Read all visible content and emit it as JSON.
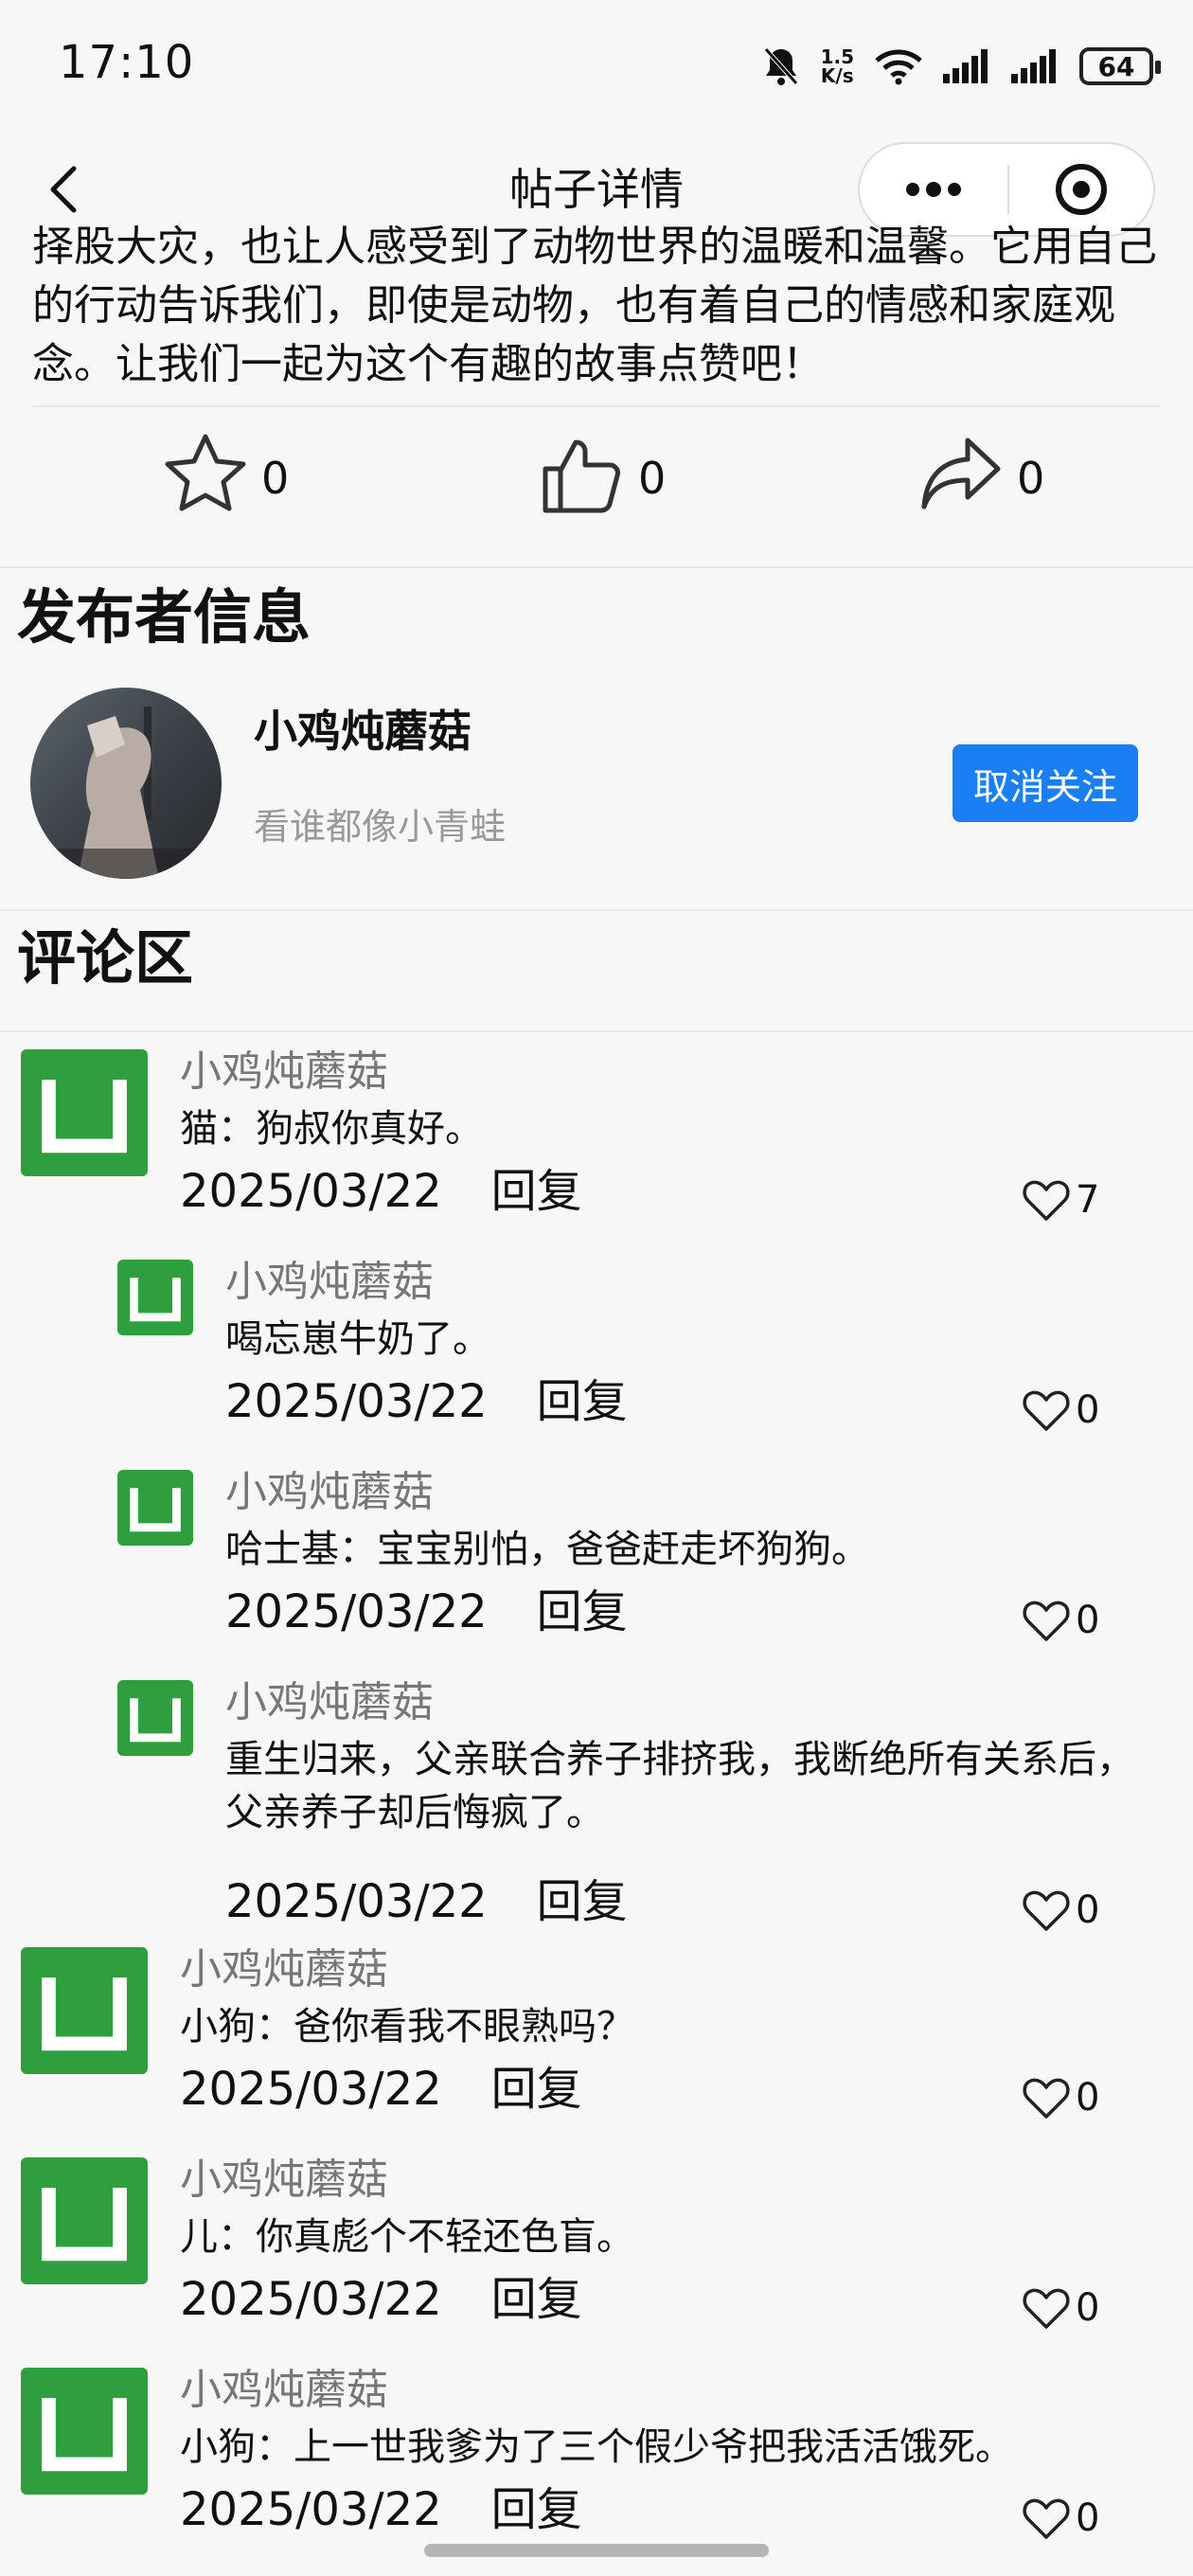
{
  "status_bar": {
    "time": "17:10",
    "speed_value": "1.5",
    "speed_unit": "K/s",
    "battery": "64",
    "icons": [
      "bell-muted-icon",
      "network-speed",
      "wifi-icon",
      "signal-icon",
      "signal-icon",
      "battery-icon"
    ]
  },
  "nav": {
    "title": "帖子详情",
    "back_icon": "chevron-left-icon",
    "more_icon": "more-dots-icon",
    "close_icon": "target-close-icon"
  },
  "post": {
    "text": "择股大灾，也让人感受到了动物世界的温暖和温馨。它用自己的行动告诉我们，即使是动物，也有着自己的情感和家庭观念。让我们一起为这个有趣的故事点赞吧！"
  },
  "actions": {
    "favorite_count": "0",
    "like_count": "0",
    "share_count": "0"
  },
  "publisher": {
    "heading": "发布者信息",
    "name": "小鸡炖蘑菇",
    "bio": "看谁都像小青蛙",
    "unfollow_label": "取消关注"
  },
  "comments_section": {
    "heading": "评论区",
    "reply_label": "回复",
    "items": [
      {
        "user": "小鸡炖蘑菇",
        "text": "猫：狗叔你真好。",
        "date": "2025/03/22",
        "likes": "7",
        "level": 0
      },
      {
        "user": "小鸡炖蘑菇",
        "text": "喝忘崽牛奶了。",
        "date": "2025/03/22",
        "likes": "0",
        "level": 1
      },
      {
        "user": "小鸡炖蘑菇",
        "text": "哈士基：宝宝别怕，爸爸赶走坏狗狗。",
        "date": "2025/03/22",
        "likes": "0",
        "level": 1
      },
      {
        "user": "小鸡炖蘑菇",
        "text": "重生归来，父亲联合养子排挤我，我断绝所有关系后，父亲养子却后悔疯了。",
        "date": "2025/03/22",
        "likes": "0",
        "level": 1
      },
      {
        "user": "小鸡炖蘑菇",
        "text": "小狗：爸你看我不眼熟吗？",
        "date": "2025/03/22",
        "likes": "0",
        "level": 0
      },
      {
        "user": "小鸡炖蘑菇",
        "text": "儿：你真彪个不轻还色盲。",
        "date": "2025/03/22",
        "likes": "0",
        "level": 0
      },
      {
        "user": "小鸡炖蘑菇",
        "text": "小狗：上一世我爹为了三个假少爷把我活活饿死。",
        "date": "2025/03/22",
        "likes": "0",
        "level": 0
      }
    ]
  }
}
